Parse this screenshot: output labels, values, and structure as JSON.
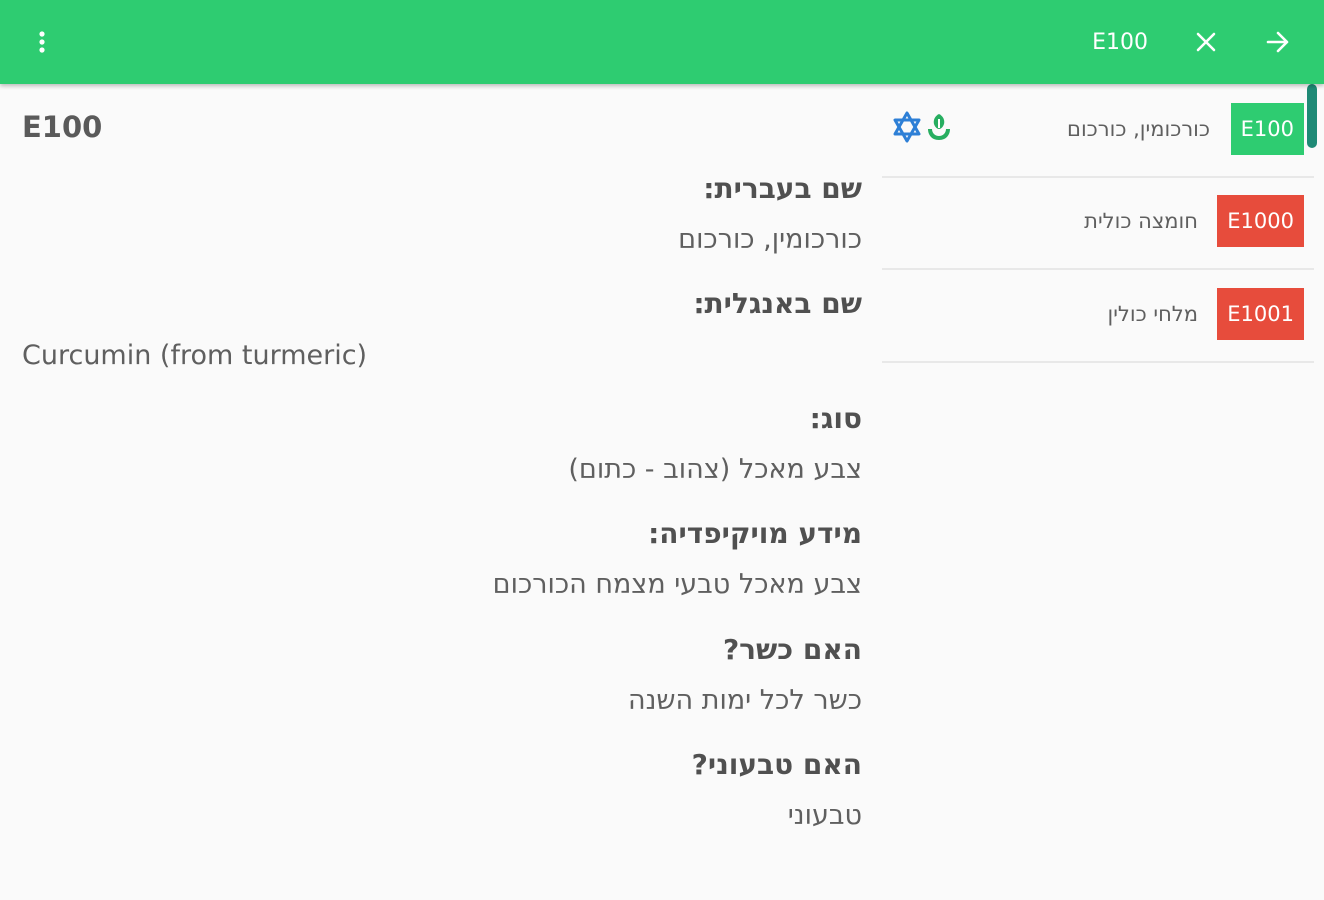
{
  "colors": {
    "appbar": "#2ecc71",
    "badge_green": "#2ecc71",
    "badge_red": "#e74c3c",
    "kosher_icon": "#2d7fd6",
    "vegan_icon": "#27ae60",
    "scrollbar": "#1f8a76"
  },
  "appbar": {
    "search_value": "E100",
    "icons": {
      "menu": "more-vert-icon",
      "close": "close-icon",
      "forward": "arrow-forward-icon"
    }
  },
  "detail": {
    "code": "E100",
    "fields": [
      {
        "label": "שם בעברית:",
        "value": "כורכומין, כורכום"
      },
      {
        "label": "שם באנגלית:",
        "value": "Curcumin (from turmeric)"
      },
      {
        "label": "סוג:",
        "value": "צבע מאכל (צהוב - כתום)"
      },
      {
        "label": "מידע מויקיפדיה:",
        "value": "צבע מאכל טבעי מצמח הכורכום"
      },
      {
        "label": "האם כשר?",
        "value": "כשר לכל ימות השנה"
      },
      {
        "label": "האם טבעוני?",
        "value": "טבעוני"
      }
    ]
  },
  "list": {
    "items": [
      {
        "code": "E100",
        "name": "כורכומין, כורכום",
        "status": "green",
        "icons": [
          "star-of-david-icon",
          "vegan-icon"
        ]
      },
      {
        "code": "E1000",
        "name": "חומצה כולית",
        "status": "red"
      },
      {
        "code": "E1001",
        "name": "מלחי כולין",
        "status": "red"
      }
    ]
  }
}
